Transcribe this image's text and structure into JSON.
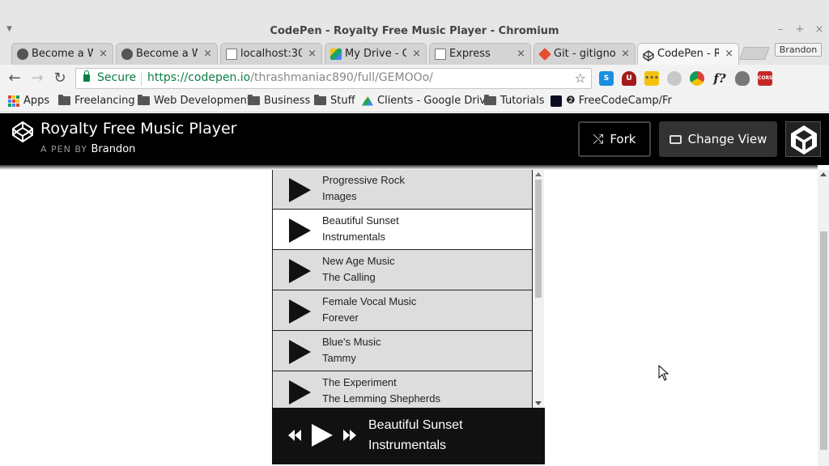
{
  "window": {
    "title": "CodePen - Royalty Free Music Player - Chromium",
    "controls": [
      "–",
      "+",
      "×"
    ]
  },
  "tabs": [
    {
      "label": "Become a W",
      "favicon_color": "#555555"
    },
    {
      "label": "Become a W",
      "favicon_color": "#555555"
    },
    {
      "label": "localhost:30",
      "favicon_color": "#888888"
    },
    {
      "label": "My Drive - G",
      "favicon_color": "#1fa463"
    },
    {
      "label": "Express",
      "favicon_color": "#888888"
    },
    {
      "label": "Git - gitignor",
      "favicon_color": "#e84d31"
    },
    {
      "label": "CodePen - R",
      "favicon_color": "#333333",
      "active": true
    }
  ],
  "profile": {
    "label": "Brandon"
  },
  "toolbar": {
    "secure_label": "Secure",
    "url_prefix": "https://",
    "url_host": "codepen.io",
    "url_path": "/thrashmaniac890/full/GEMOOo/"
  },
  "extensions": [
    {
      "name": "skype-ext-icon",
      "color": "#1a8fe0",
      "label": "S"
    },
    {
      "name": "ublock-ext-icon",
      "color": "#a11b1b",
      "label": "U"
    },
    {
      "name": "notes-ext-icon",
      "color": "#f4c20d",
      "label": "•••"
    },
    {
      "name": "gray-ext-icon",
      "color": "#c8c8c8",
      "label": ""
    },
    {
      "name": "chrome-ext-icon",
      "color": "#4285f4",
      "label": ""
    },
    {
      "name": "font-ext-icon",
      "color": "#f2f2f2",
      "label": "f?"
    },
    {
      "name": "bug-ext-icon",
      "color": "#777777",
      "label": ""
    },
    {
      "name": "cors-ext-icon",
      "color": "#c62828",
      "label": "CORS"
    }
  ],
  "bookmarks": [
    {
      "label": "Apps",
      "type": "apps"
    },
    {
      "label": "Freelancing",
      "type": "folder"
    },
    {
      "label": "Web Development",
      "type": "folder"
    },
    {
      "label": "Business",
      "type": "folder"
    },
    {
      "label": "Stuff",
      "type": "folder"
    },
    {
      "label": "Clients - Google Driv",
      "type": "drive"
    },
    {
      "label": "Tutorials",
      "type": "folder"
    },
    {
      "label": "❷ FreeCodeCamp/Fr",
      "type": "fcc"
    }
  ],
  "codepen": {
    "title": "Royalty Free Music Player",
    "byline_prefix": "A PEN BY",
    "author": "Brandon",
    "fork_label": "Fork",
    "change_view_label": "Change View"
  },
  "playlist": [
    {
      "title": "Progressive Rock",
      "artist": "Images",
      "selected": false
    },
    {
      "title": "Beautiful Sunset",
      "artist": "Instrumentals",
      "selected": true
    },
    {
      "title": "New Age Music",
      "artist": "The Calling",
      "selected": false
    },
    {
      "title": "Female Vocal Music",
      "artist": "Forever",
      "selected": false
    },
    {
      "title": "Blue's Music",
      "artist": "Tammy",
      "selected": false
    },
    {
      "title": "The Experiment",
      "artist": "The Lemming Shepherds",
      "selected": false
    }
  ],
  "now_playing": {
    "title": "Beautiful Sunset",
    "artist": "Instrumentals"
  }
}
